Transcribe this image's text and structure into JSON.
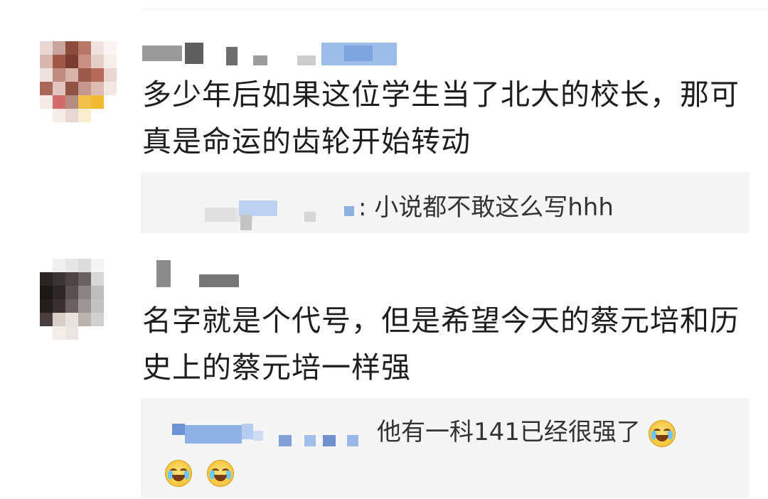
{
  "comments": [
    {
      "text": "多少年后如果这位学生当了北大的校长，那可真是命运的齿轮开始转动",
      "reply": {
        "text": ": 小说都不敢这么写hhh"
      }
    },
    {
      "text": "名字就是个代号，但是希望今天的蔡元培和历史上的蔡元培一样强",
      "reply": {
        "text": "他有一科141已经很强了",
        "emoji_icons": [
          "laughing-crying-emoji-icon",
          "laughing-crying-emoji-icon",
          "laughing-crying-emoji-icon"
        ]
      }
    }
  ],
  "colors": {
    "reply_bg": "#f5f5f5",
    "blur_blue": "#8fb4e8",
    "text": "#1e1e1e"
  }
}
